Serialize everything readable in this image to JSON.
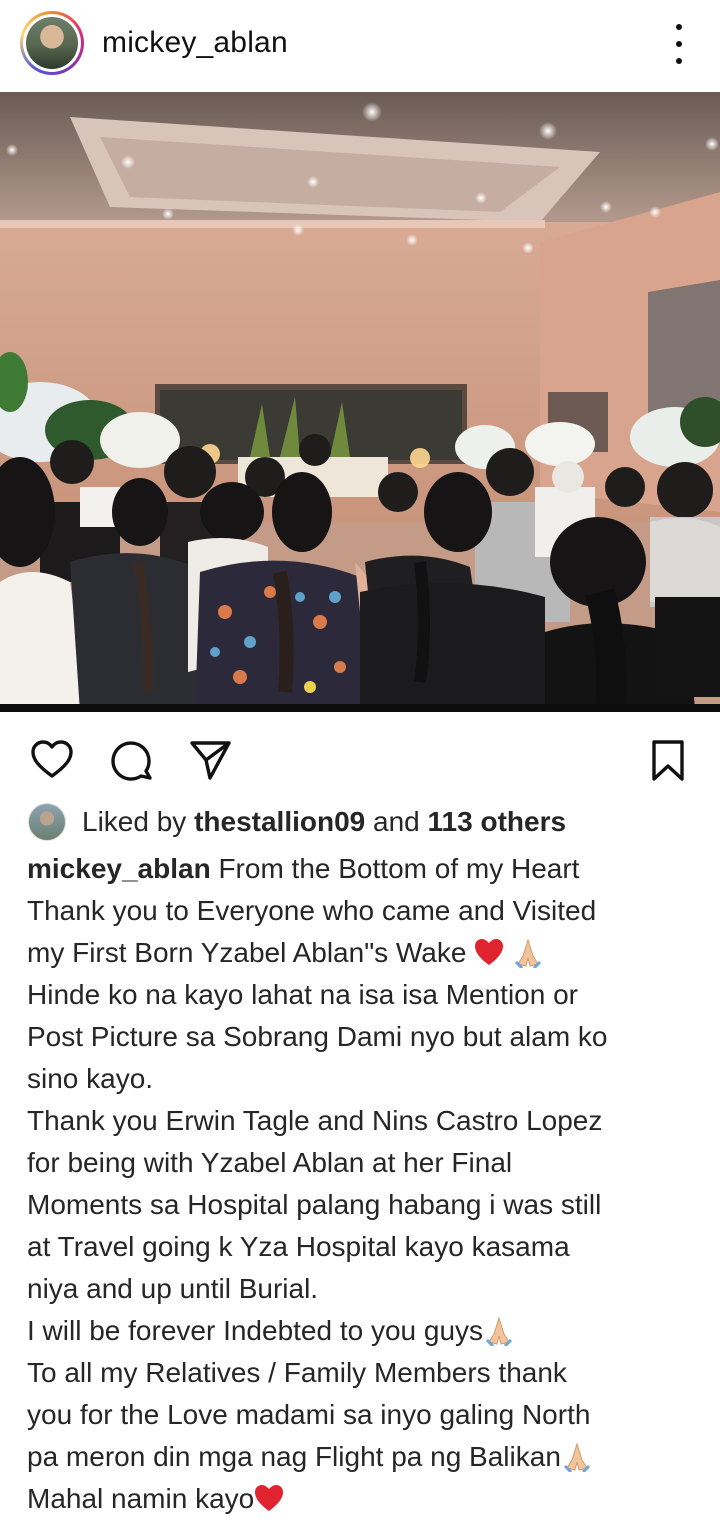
{
  "post": {
    "username": "mickey_ablan"
  },
  "likes": {
    "prefix": "Liked by",
    "user": "thestallion09",
    "middle": "and",
    "others": "113 others"
  },
  "caption": {
    "username": "mickey_ablan",
    "line_1_rest": "From the Bottom of my Heart",
    "lines": [
      "Thank you to Everyone who came and Visited",
      "my First Born Yzabel Ablan\"s Wake",
      "Hinde ko na kayo lahat na isa isa Mention or",
      "Post Picture sa Sobrang Dami nyo but alam ko",
      "sino kayo.",
      "Thank you Erwin Tagle and Nins Castro Lopez",
      "for being with Yzabel Ablan at her Final",
      "Moments sa Hospital palang habang i was still",
      "at Travel going k Yza Hospital kayo kasama",
      "niya and up until Burial.",
      "I will be forever Indebted to you guys",
      "To all my Relatives / Family Members thank",
      "you for the Love  madami sa inyo galing North",
      "pa meron din mga nag Flight pa ng Balikan",
      "Mahal namin kayo"
    ]
  },
  "icons": {
    "header_more": "more-vertical-icon",
    "like": "heart-icon",
    "comment": "comment-icon",
    "share": "send-icon",
    "save": "bookmark-icon",
    "emoji_heart": "red-heart-emoji",
    "emoji_pray": "folded-hands-emoji"
  },
  "colors": {
    "text": "#262626",
    "emoji_heart": "#e0242f",
    "emoji_pray": "#f2c49b"
  }
}
